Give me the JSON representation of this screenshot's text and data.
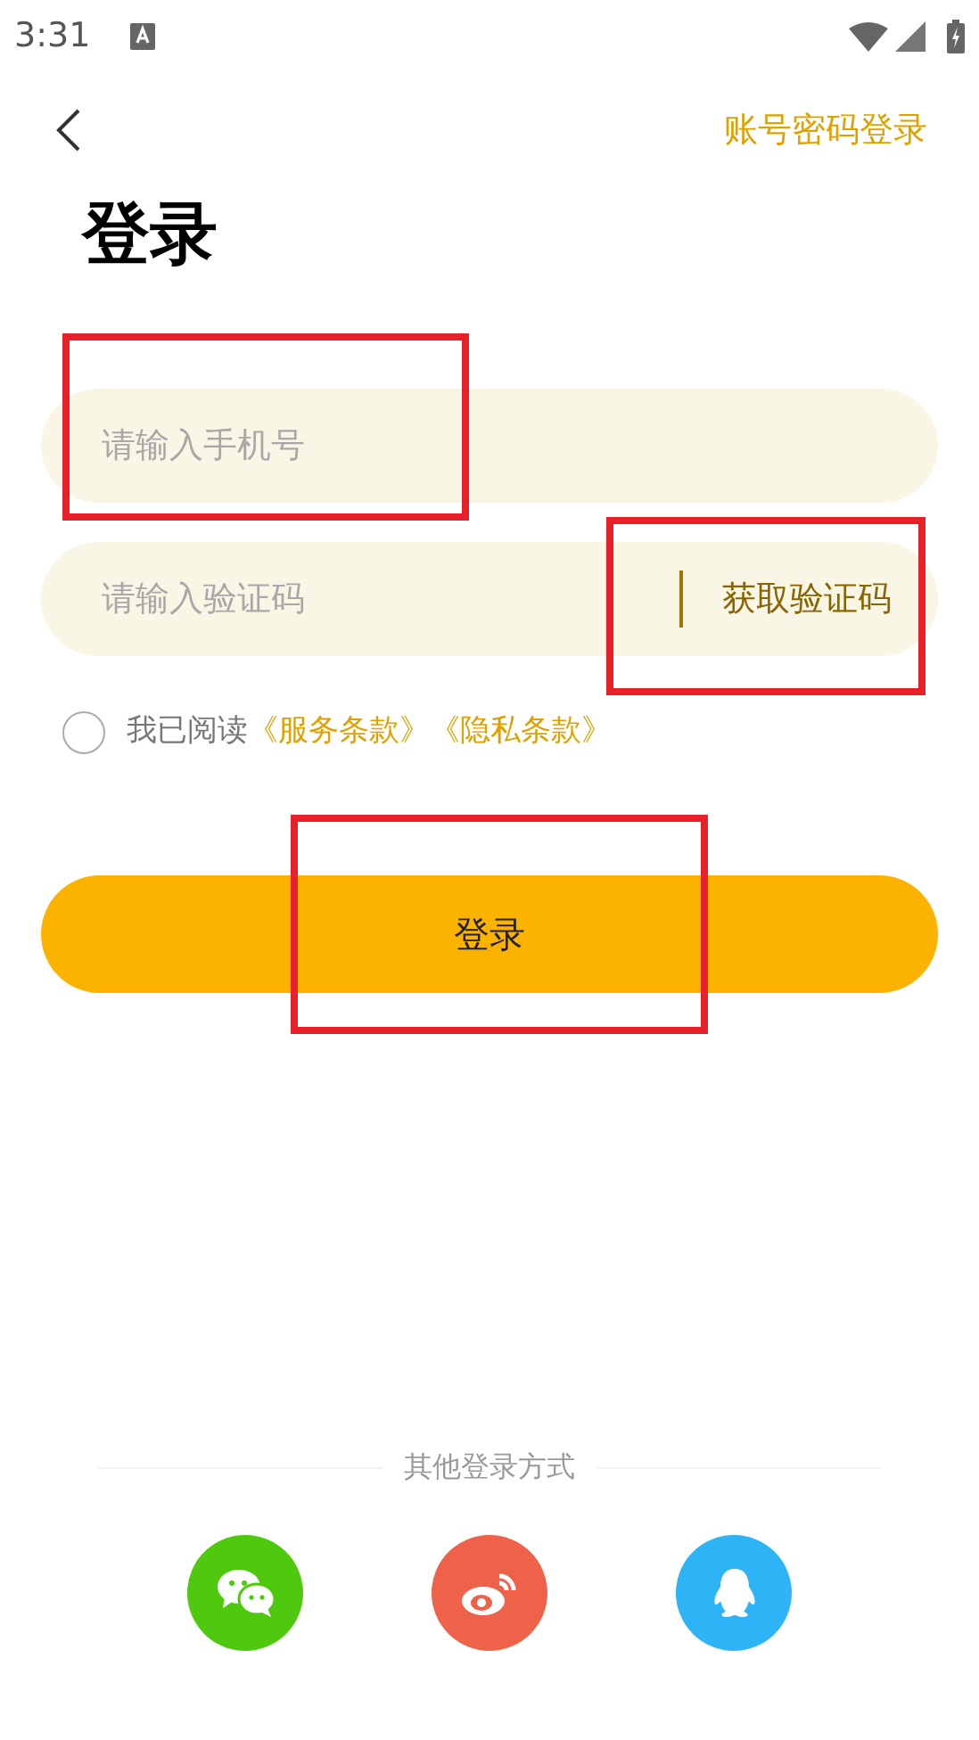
{
  "status_bar": {
    "time": "3:31"
  },
  "nav": {
    "action": "账号密码登录"
  },
  "title": "登录",
  "phone_field": {
    "placeholder": "请输入手机号"
  },
  "code_field": {
    "placeholder": "请输入验证码",
    "button": "获取验证码"
  },
  "agreement": {
    "checked": false,
    "text": "我已阅读",
    "links": [
      "《服务条款》",
      "《隐私条款》"
    ]
  },
  "login_button": "登录",
  "other_login": {
    "label": "其他登录方式",
    "options": [
      {
        "kind": "wechat",
        "color": "#4fc90d"
      },
      {
        "kind": "weibo",
        "color": "#ef624a"
      },
      {
        "kind": "qq",
        "color": "#2db4f7"
      }
    ]
  }
}
